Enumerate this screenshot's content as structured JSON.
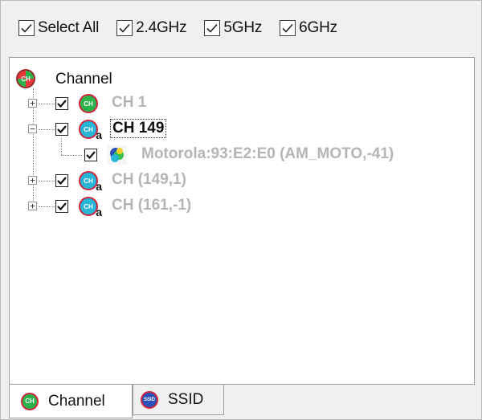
{
  "filters": {
    "select_all": {
      "label": "Select All",
      "checked": true
    },
    "band_24": {
      "label": "2.4GHz",
      "checked": true
    },
    "band_5": {
      "label": "5GHz",
      "checked": true
    },
    "band_6": {
      "label": "6GHz",
      "checked": true
    }
  },
  "tree": {
    "root": {
      "label": "Channel",
      "icon": "channel-icon"
    },
    "nodes": [
      {
        "label": "CH 1",
        "checked": true,
        "expanded": false,
        "state": "greyed",
        "icon": "channel-2g-icon"
      },
      {
        "label": "CH 149",
        "checked": true,
        "expanded": true,
        "state": "selected",
        "icon": "channel-5g-icon",
        "children": [
          {
            "label": "Motorola:93:E2:E0 (AM_MOTO,-41)",
            "checked": true,
            "state": "greyed",
            "icon": "client-device-icon"
          }
        ]
      },
      {
        "label": "CH (149,1)",
        "checked": true,
        "expanded": false,
        "state": "greyed",
        "icon": "channel-5g-icon"
      },
      {
        "label": "CH (161,-1)",
        "checked": true,
        "expanded": false,
        "state": "greyed",
        "icon": "channel-5g-icon"
      }
    ]
  },
  "tabs": [
    {
      "label": "Channel",
      "active": true,
      "icon": "channel-icon",
      "icon_text": "CH"
    },
    {
      "label": "SSID",
      "active": false,
      "icon": "ssid-icon",
      "icon_text": "SSID"
    }
  ],
  "icon_texts": {
    "channel": "CH",
    "sub_a": "a"
  },
  "colors": {
    "greyed_text": "#b5b5b5",
    "channel_green": "#2ab34a",
    "channel_blue": "#27b6d8",
    "icon_ring": "#d4243c",
    "ssid_blue": "#2d4fb8"
  }
}
